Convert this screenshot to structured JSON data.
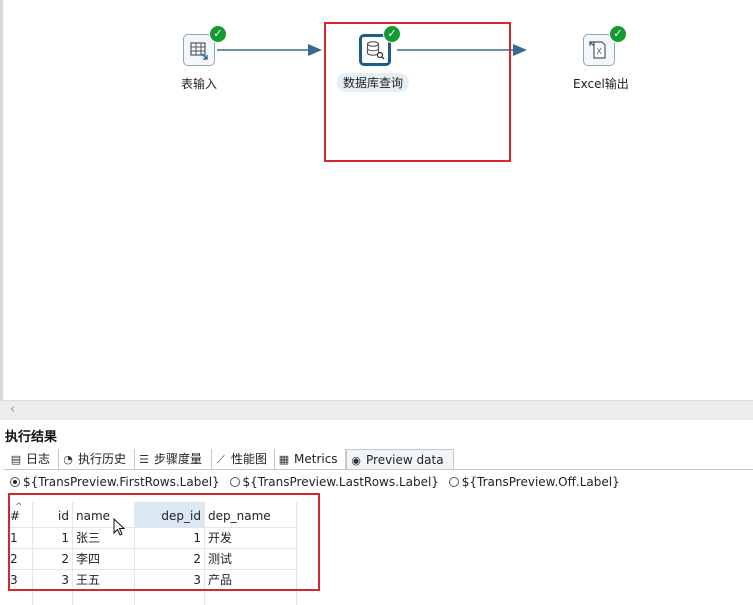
{
  "canvas": {
    "steps": [
      {
        "label": "表输入"
      },
      {
        "label": "数据库查询"
      },
      {
        "label": "Excel输出"
      }
    ]
  },
  "results": {
    "title": "执行结果",
    "tabs": [
      "日志",
      "执行历史",
      "步骤度量",
      "性能图",
      "Metrics",
      "Preview data"
    ],
    "radios": [
      "${TransPreview.FirstRows.Label}",
      "${TransPreview.LastRows.Label}",
      "${TransPreview.Off.Label}"
    ],
    "grid": {
      "headers": [
        "#",
        "id",
        "name",
        "dep_id",
        "dep_name"
      ],
      "rows": [
        [
          "1",
          "1",
          "张三",
          "1",
          "开发"
        ],
        [
          "2",
          "2",
          "李四",
          "2",
          "测试"
        ],
        [
          "3",
          "3",
          "王五",
          "3",
          "产品"
        ]
      ]
    }
  },
  "colors": {
    "highlight": "#d8262c",
    "success": "#149a30",
    "selected_step": "#1a5c8a"
  }
}
